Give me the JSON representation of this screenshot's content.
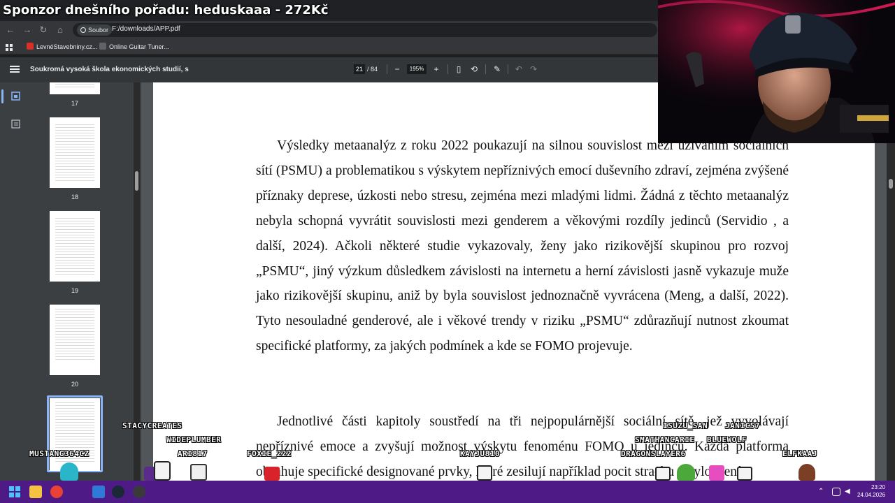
{
  "overlay": {
    "stream_title": "Sponzor dnešního pořadu: heduskaaa - 272Kč",
    "chat_names": [
      "STACYCREATES",
      "WIDEPLUMBER",
      "MUSTANG364CZ",
      "ARI817",
      "FOXIE_222",
      "KAYJU810",
      "ISUZU_SAN",
      "JANIC57",
      "SMATHANCARIE",
      "BLUEWOLF",
      "DRAGONSLAYER6",
      "ELFKAAJ"
    ]
  },
  "browser": {
    "site_info": "Soubor",
    "url": "F:/downloads/APP.pdf",
    "bookmarks": [
      "LevnéStavebniny.cz...",
      "Online Guitar Tuner..."
    ]
  },
  "pdf": {
    "title": "Soukromá vysoká škola ekonomických studií, s",
    "current_page": "21",
    "page_total": "/ 84",
    "zoom": "195%",
    "thumbnails": [
      "17",
      "18",
      "19",
      "20"
    ],
    "paragraphs": [
      "Výsledky metaanalýz z roku 2022 poukazují na silnou souvislost mezi užíváním sociálních sítí (PSMU) a problematikou s výskytem nepříznivých emocí duševního zdraví, zejména zvýšené příznaky deprese, úzkosti nebo stresu, zejména mezi mladými lidmi. Žádná z těchto metaanalýz nebyla schopná vyvrátit souvislosti mezi genderem a věkovými rozdíly jedinců (Servidio , a další, 2024). Ačkoli některé studie vykazovaly, ženy jako rizikovější skupinou pro rozvoj „PSMU“, jiný výzkum důsledkem závislosti na internetu a herní závislosti jasně vykazuje muže jako rizikovější skupinu, aniž by byla souvislost jednoznačně vyvrácena (Meng, a další, 2022). Tyto nesouladné genderové, ale i věkové trendy v riziku „PSMU“ zdůrazňují nutnost zkoumat specifické platformy, za jakých podmínek a kde se FOMO projevuje.",
      "Jednotlivé části kapitoly soustředí na tři nejpopulárnější sociální sítě, jež vyvolávají nepříznivé emoce a zvyšují možnost výskytu fenoménu FOMO u jedinců. Každá platforma obsahuje specifické designované prvky, které zesilují například pocit strachu z vyloučení"
    ]
  },
  "taskbar": {
    "time": "23:20",
    "date": "24.04.2026"
  }
}
